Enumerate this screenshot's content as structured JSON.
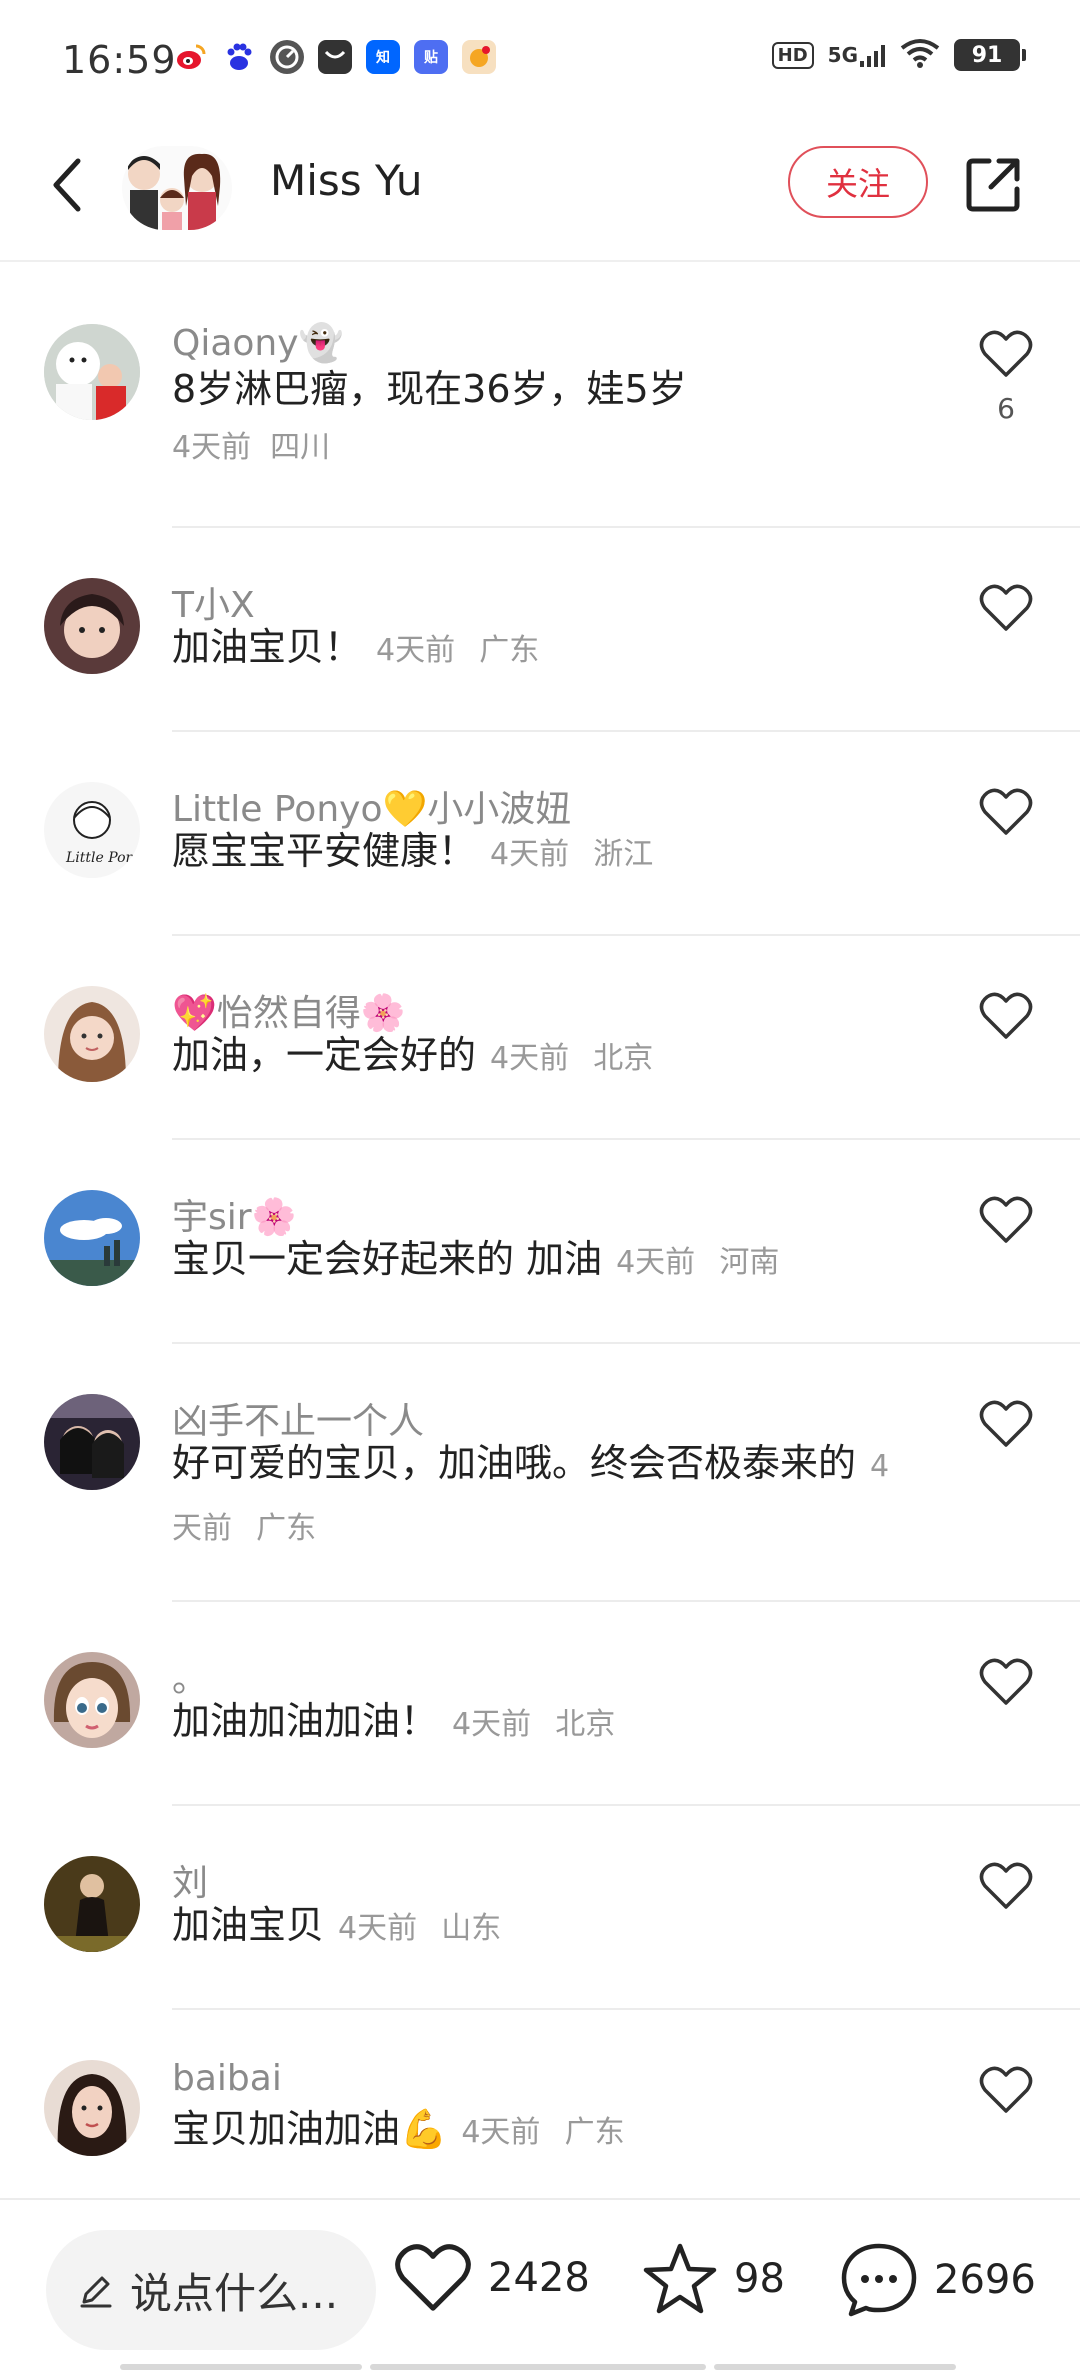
{
  "status_bar": {
    "time": "16:59",
    "apps": [
      {
        "icon": "weibo-icon",
        "color": "#e6162d"
      },
      {
        "icon": "baidu-icon",
        "color": "#2932e1"
      },
      {
        "icon": "speed-icon",
        "color": "#555555"
      },
      {
        "icon": "mail-icon",
        "color": "#333333"
      },
      {
        "icon": "zhihu-icon",
        "color": "#0066ff"
      },
      {
        "icon": "tieba-icon",
        "color": "#4e6ef2"
      },
      {
        "icon": "game-icon",
        "color": "#f5a623"
      }
    ],
    "hd": "HD",
    "network": "5G",
    "battery": "91"
  },
  "header": {
    "title": "Miss Yu",
    "follow_label": "关注"
  },
  "comments": [
    {
      "name": "Qiaony👻",
      "text": "8岁淋巴瘤，现在36岁，娃5岁",
      "time": "4天前",
      "location": "四川",
      "likes": "6",
      "avatar_color": "#d9d9d9"
    },
    {
      "name": "T小X",
      "text": "加油宝贝！",
      "time": "4天前",
      "location": "广东",
      "likes": "",
      "avatar_color": "#c9a38a"
    },
    {
      "name": "Little Ponyo💛小小波妞",
      "text": "愿宝宝平安健康！",
      "time": "4天前",
      "location": "浙江",
      "likes": "",
      "avatar_color": "#f4f4f4"
    },
    {
      "name": "💖怡然自得🌸",
      "text": "加油，一定会好的",
      "time": "4天前",
      "location": "北京",
      "likes": "",
      "avatar_color": "#e8c8b8"
    },
    {
      "name": "宇sir🌸",
      "text": "宝贝一定会好起来的 加油",
      "time": "4天前",
      "location": "河南",
      "likes": "",
      "avatar_color": "#6a9fd8"
    },
    {
      "name": "凶手不止一个人",
      "text": "好可爱的宝贝，加油哦。终会否极泰来的",
      "time": "4天前",
      "location": "广东",
      "likes": "",
      "avatar_color": "#3a3040"
    },
    {
      "name": "。",
      "text": "加油加油加油！",
      "time": "4天前",
      "location": "北京",
      "likes": "",
      "avatar_color": "#b8a090"
    },
    {
      "name": "刘",
      "text": "加油宝贝",
      "time": "4天前",
      "location": "山东",
      "likes": "",
      "avatar_color": "#5a4a2a"
    },
    {
      "name": "baibai",
      "text": "宝贝加油加油💪",
      "time": "4天前",
      "location": "广东",
      "likes": "",
      "avatar_color": "#e2c4b0"
    }
  ],
  "bottom_bar": {
    "input_placeholder": "说点什么...",
    "likes": "2428",
    "favorites": "98",
    "comments": "2696"
  }
}
